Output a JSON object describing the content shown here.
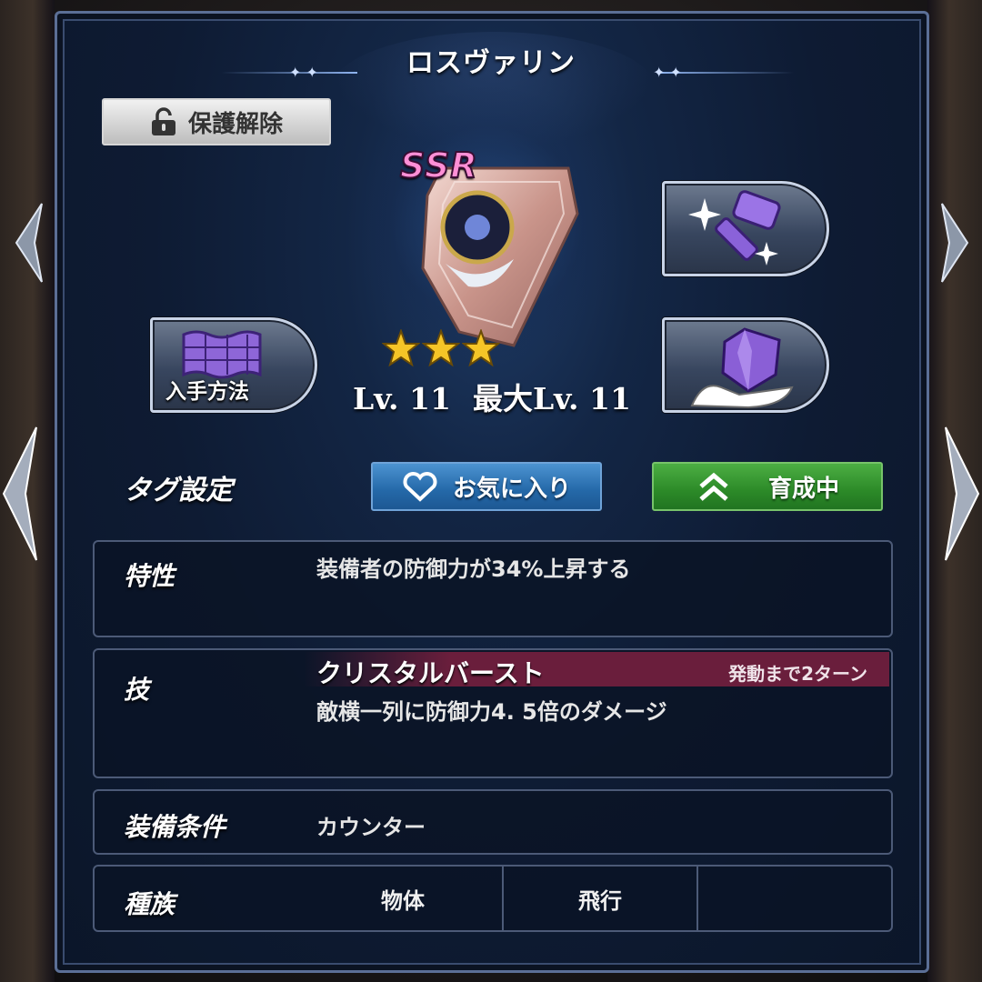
{
  "title": "ロスヴァリン",
  "protect_button": {
    "label": "保護解除",
    "icon": "unlock-icon"
  },
  "item": {
    "rarity": "SSR",
    "stars": 3,
    "level": "Lv. 11",
    "max_level": "最大Lv. 11"
  },
  "acquire_button": {
    "label": "入手方法",
    "icon": "map-scroll-icon"
  },
  "enhance_button": {
    "icon": "hammer-sparkle-icon"
  },
  "sell_button": {
    "icon": "gem-hand-icon"
  },
  "tags": {
    "label": "タグ設定",
    "favorite": "お気に入り",
    "training": "育成中"
  },
  "trait": {
    "label": "特性",
    "text": "装備者の防御力が34%上昇する"
  },
  "skill": {
    "label": "技",
    "name": "クリスタルバースト",
    "turns": "発動まで2ターン",
    "text": "敵横一列に防御力4. 5倍のダメージ"
  },
  "condition": {
    "label": "装備条件",
    "text": "カウンター"
  },
  "race": {
    "label": "種族",
    "values": [
      "物体",
      "飛行",
      ""
    ]
  },
  "colors": {
    "favorite_button": "#2468a8",
    "training_button": "#2c8a28",
    "skill_bar": "#6a1e3c",
    "ssr_text": "#ff8fd6"
  }
}
